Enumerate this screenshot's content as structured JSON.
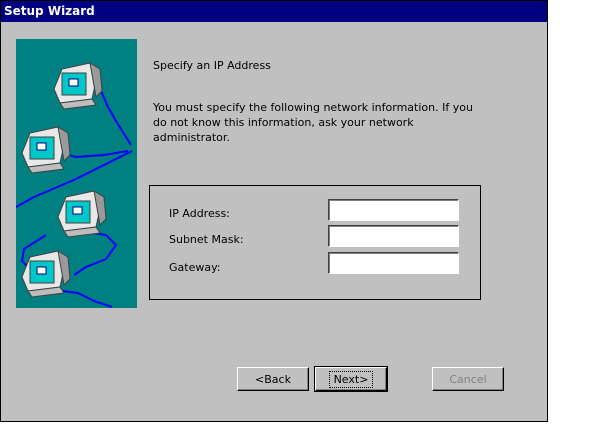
{
  "window": {
    "title": "Setup Wizard"
  },
  "content": {
    "heading": "Specify an IP Address",
    "description": "You must specify the following network information.  If you do not know this information, ask your network administrator."
  },
  "fields": {
    "ip_address": {
      "label": "IP Address:",
      "value": ""
    },
    "subnet_mask": {
      "label": "Subnet Mask:",
      "value": ""
    },
    "gateway": {
      "label": "Gateway:",
      "value": ""
    }
  },
  "buttons": {
    "back": "<Back",
    "next": "Next>",
    "cancel": "Cancel"
  },
  "colors": {
    "titlebar": "#000080",
    "window_bg": "#c0c0c0",
    "art_bg": "#008080",
    "network_line": "#0000ff"
  },
  "icons": [
    "computer-icon",
    "computer-icon",
    "computer-icon",
    "computer-icon"
  ]
}
